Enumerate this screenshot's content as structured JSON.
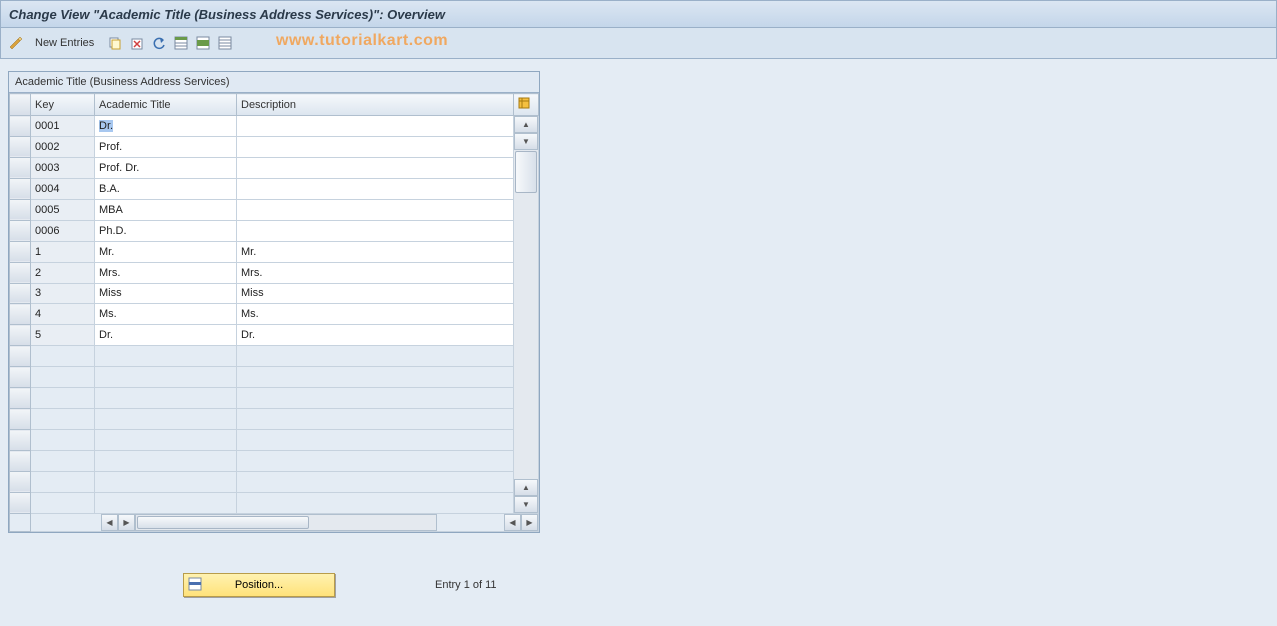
{
  "header": {
    "title": "Change View \"Academic Title (Business Address Services)\": Overview"
  },
  "toolbar": {
    "new_entries_label": "New Entries"
  },
  "watermark": "www.tutorialkart.com",
  "table": {
    "title": "Academic Title (Business Address Services)",
    "columns": {
      "key": "Key",
      "academic_title": "Academic Title",
      "description": "Description"
    },
    "rows": [
      {
        "key": "0001",
        "title": "Dr.",
        "desc": "",
        "selected_title": true
      },
      {
        "key": "0002",
        "title": "Prof.",
        "desc": ""
      },
      {
        "key": "0003",
        "title": "Prof. Dr.",
        "desc": ""
      },
      {
        "key": "0004",
        "title": "B.A.",
        "desc": ""
      },
      {
        "key": "0005",
        "title": "MBA",
        "desc": ""
      },
      {
        "key": "0006",
        "title": "Ph.D.",
        "desc": ""
      },
      {
        "key": "1",
        "title": "Mr.",
        "desc": "Mr."
      },
      {
        "key": "2",
        "title": "Mrs.",
        "desc": "Mrs."
      },
      {
        "key": "3",
        "title": "Miss",
        "desc": "Miss"
      },
      {
        "key": "4",
        "title": "Ms.",
        "desc": "Ms."
      },
      {
        "key": "5",
        "title": "Dr.",
        "desc": "Dr."
      }
    ],
    "empty_rows": 8
  },
  "footer": {
    "position_label": "Position...",
    "entry_status": "Entry 1 of 11"
  },
  "icons": {
    "pencil": "pencil-icon",
    "copy": "copy-icon",
    "delete": "delete-icon",
    "undo": "undo-icon",
    "select_all": "select-all-icon",
    "select_block": "select-block-icon",
    "deselect_all": "deselect-all-icon",
    "settings": "table-settings-icon"
  }
}
